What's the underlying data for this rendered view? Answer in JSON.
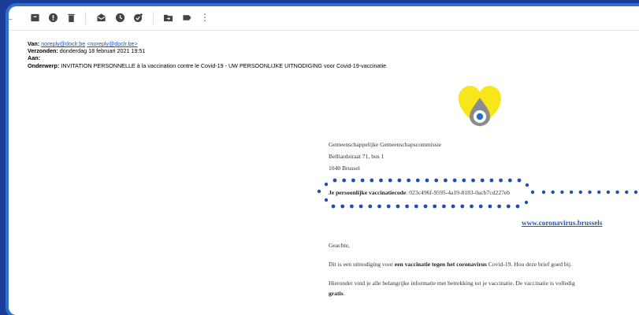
{
  "toolbar": {
    "icons": [
      "back-arrow-icon",
      "archive-icon",
      "report-spam-icon",
      "delete-icon",
      "mark-unread-icon",
      "snooze-icon",
      "add-task-icon",
      "move-to-icon",
      "label-icon",
      "more-icon"
    ],
    "back_glyph": "←",
    "more_glyph": "⋮"
  },
  "email_headers": {
    "from_label": "Van:",
    "from_name": "noreply@doclr.be",
    "from_email": "<noreply@doclr.be>",
    "sent_label": "Verzonden:",
    "sent_value": "donderdag 18 februari 2021 19:51",
    "to_label": "Aan:",
    "to_value": "",
    "subject_label": "Onderwerp:",
    "subject_value": "INVITATION PERSONNELLE à la vaccination contre le Covid-19 - UW PERSOONLIJKE UITNODIGING voor Covid-19-vaccinatie"
  },
  "letter": {
    "org_line1": "Gemeenschappelijke Gemeenschapscommissie",
    "org_line2": "Belliardstraat 71, bus 1",
    "org_line3": "1040 Brussel",
    "code_label": "Je persoonlijke vaccinatiecode",
    "code_value": ": 023c496f-9595-4a19-8183-0acb7cd227eb",
    "website": "www.coronavirus.brussels",
    "greeting": "Geachte,",
    "para1_pre": "Dit is een uitnodiging voor ",
    "para1_bold": "een vaccinatie tegen het coronavirus",
    "para1_post": " Covid-19. Hou deze brief goed bij.",
    "para2_line1": "Hieronder vind je alle belangrijke informatie met betrekking tot je vaccinatie. De vaccinatie is volledig",
    "para2_bold": "gratis",
    "para2_end": "."
  },
  "colors": {
    "frame_bg": "#1a3d9a",
    "frame_border": "#2f6fd0",
    "dots": "#1f4fae",
    "link": "#2356c8",
    "logo_yellow": "#f6e61a",
    "logo_grey": "#8a8c8f"
  }
}
